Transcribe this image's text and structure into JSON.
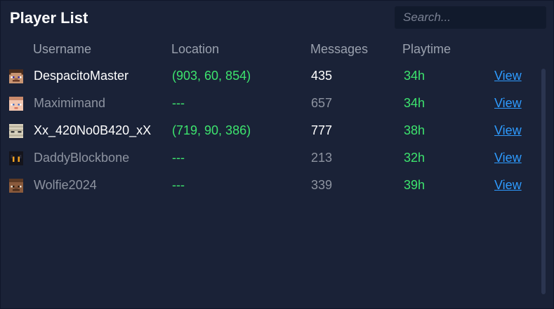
{
  "header": {
    "title": "Player List",
    "search_placeholder": "Search..."
  },
  "columns": {
    "username": "Username",
    "location": "Location",
    "messages": "Messages",
    "playtime": "Playtime"
  },
  "players": [
    {
      "username": "DespacitoMaster",
      "location": "(903, 60, 854)",
      "messages": "435",
      "playtime": "34h",
      "action": "View",
      "online": true,
      "avatar": "steve-face-icon"
    },
    {
      "username": "Maximimand",
      "location": "---",
      "messages": "657",
      "playtime": "34h",
      "action": "View",
      "online": false,
      "avatar": "skin-face-icon"
    },
    {
      "username": "Xx_420No0B420_xX",
      "location": "(719, 90, 386)",
      "messages": "777",
      "playtime": "38h",
      "action": "View",
      "online": true,
      "avatar": "mummy-face-icon"
    },
    {
      "username": "DaddyBlockbone",
      "location": "---",
      "messages": "213",
      "playtime": "32h",
      "action": "View",
      "online": false,
      "avatar": "dark-face-icon"
    },
    {
      "username": "Wolfie2024",
      "location": "---",
      "messages": "339",
      "playtime": "39h",
      "action": "View",
      "online": false,
      "avatar": "brown-face-icon"
    }
  ],
  "colors": {
    "background": "#1a2237",
    "accent_green": "#3de46e",
    "link_blue": "#2e9bff"
  }
}
